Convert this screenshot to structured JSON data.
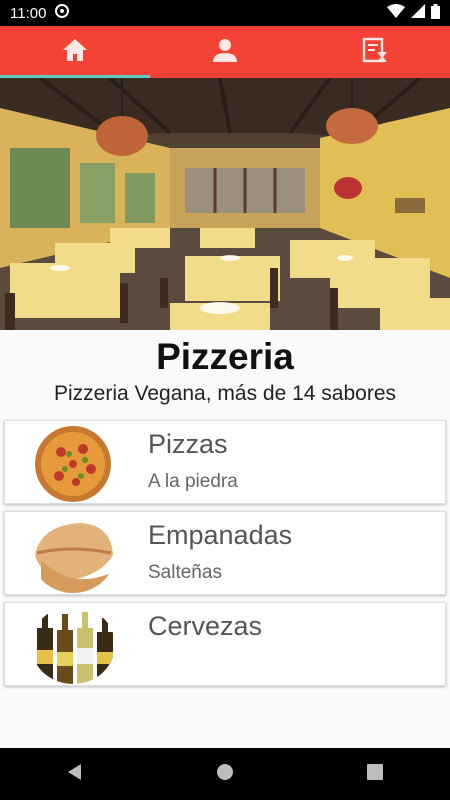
{
  "status_bar": {
    "time": "11:00",
    "icons": [
      "vpn-key-icon",
      "wifi-icon",
      "signal-icon",
      "battery-icon"
    ]
  },
  "tab_bar": {
    "color": "#f44336",
    "indicator_color": "#5fc9c2",
    "tabs": [
      {
        "icon": "home-icon",
        "active": true
      },
      {
        "icon": "person-icon",
        "active": false
      },
      {
        "icon": "menu-list-icon",
        "active": false
      }
    ]
  },
  "restaurant": {
    "name": "Pizzeria",
    "description": "Pizzeria Vegana, más de 14 sabores"
  },
  "menu_items": [
    {
      "name": "Pizzas",
      "description": "A la piedra"
    },
    {
      "name": "Empanadas",
      "description": "Salteñas"
    },
    {
      "name": "Cervezas",
      "description": ""
    }
  ],
  "nav_bar": {
    "icons": [
      "back-icon",
      "home-circle-icon",
      "recents-icon"
    ]
  }
}
